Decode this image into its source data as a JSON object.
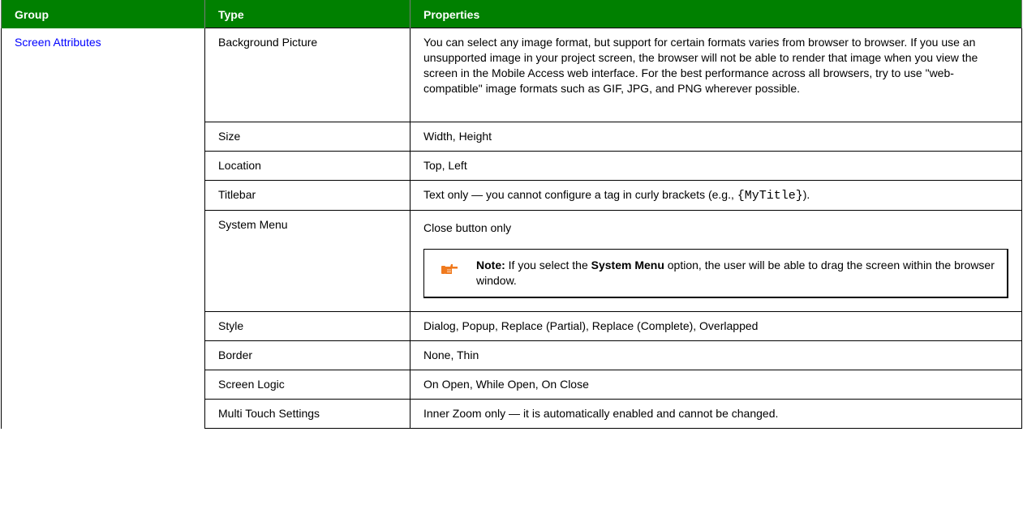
{
  "header": {
    "group": "Group",
    "type": "Type",
    "properties": "Properties"
  },
  "group_name": "Screen Attributes",
  "rows": [
    {
      "type": "Background Picture",
      "properties": "You can select any image format, but support for certain formats varies from browser to browser. If you use an unsupported image in your project screen, the browser will not be able to render that image when you view the screen in the Mobile Access web interface. For the best performance across all browsers, try to use \"web-compatible\" image formats such as GIF, JPG, and PNG wherever possible."
    },
    {
      "type": "Size",
      "properties": "Width, Height"
    },
    {
      "type": "Location",
      "properties": "Top, Left"
    },
    {
      "type": "Titlebar",
      "properties_pre": "Text only — you cannot configure a tag in curly brackets (e.g., ",
      "properties_code": "{MyTitle}",
      "properties_post": ")."
    },
    {
      "type": "System Menu",
      "properties": "Close button only",
      "note": {
        "label": "Note:",
        "pre": " If you select the ",
        "bold": "System Menu",
        "post": " option, the user will be able to drag the screen within the browser window.",
        "icon": "pointing-hand-icon"
      }
    },
    {
      "type": "Style",
      "properties": "Dialog, Popup, Replace (Partial), Replace (Complete), Overlapped"
    },
    {
      "type": "Border",
      "properties": "None, Thin"
    },
    {
      "type": "Screen Logic",
      "properties": "On Open, While Open, On Close"
    },
    {
      "type": "Multi Touch Settings",
      "properties": "Inner Zoom only — it is automatically enabled and cannot be changed."
    }
  ],
  "colors": {
    "header_bg": "#008000",
    "header_text": "#ffffff",
    "link": "#0000ff",
    "hand": "#f07a1e"
  }
}
